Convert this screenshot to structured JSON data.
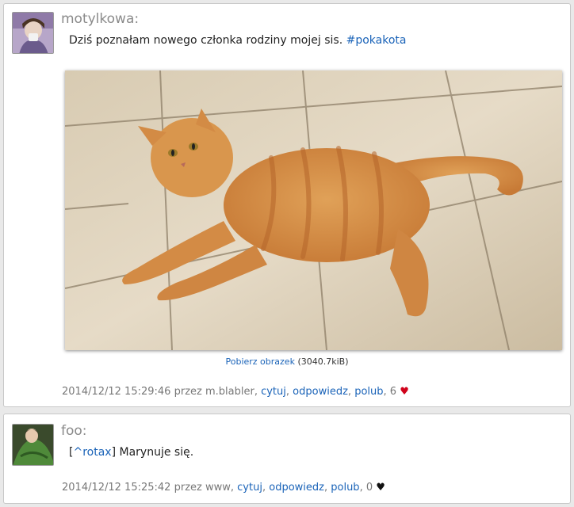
{
  "posts": [
    {
      "author": "motylkowa:",
      "text": "Dziś poznałam nowego członka rodziny mojej sis. ",
      "hashtag": "#pokakota",
      "download_label": "Pobierz obrazek",
      "download_size": "(3040.7kiB)",
      "datetime": "2014/12/12 15:29:46",
      "by_prefix": "przez",
      "by_user": "m.blabler,",
      "actions": {
        "quote": "cytuj",
        "reply": "odpowiedz",
        "like": "polub"
      },
      "likes": "6",
      "heart": "♥"
    },
    {
      "author": "foo:",
      "reply_open": "[",
      "reply_user": "^rotax",
      "reply_close": "]",
      "text": " Marynuje się.",
      "datetime": "2014/12/12 15:25:42",
      "by_prefix": "przez",
      "by_user": "www,",
      "actions": {
        "quote": "cytuj",
        "reply": "odpowiedz",
        "like": "polub"
      },
      "likes": "0",
      "heart": "♥"
    }
  ],
  "colors": {
    "link": "#1a63b8",
    "heart_liked": "#d0021b",
    "heart_unliked": "#111111",
    "author": "#8a8a8a"
  }
}
